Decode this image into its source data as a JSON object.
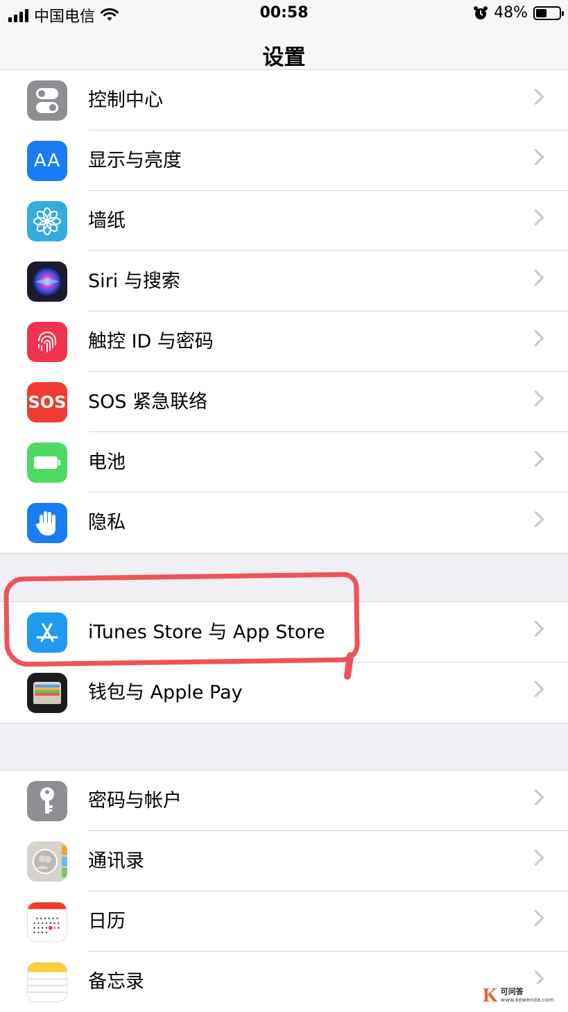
{
  "status_bar": {
    "carrier": "中国电信",
    "time": "00:58",
    "battery_percent": "48%",
    "battery_level": 0.48
  },
  "nav": {
    "title": "设置"
  },
  "groups": [
    {
      "items": [
        {
          "label": "控制中心",
          "icon": "control-center-icon",
          "color": "#8e8e93"
        },
        {
          "label": "显示与亮度",
          "icon": "display-brightness-icon",
          "color": "#1a7cf5"
        },
        {
          "label": "墙纸",
          "icon": "wallpaper-icon",
          "color": "#35aadc"
        },
        {
          "label": "Siri 与搜索",
          "icon": "siri-icon",
          "color": "#1c1c2e"
        },
        {
          "label": "触控 ID 与密码",
          "icon": "fingerprint-icon",
          "color": "#f2334f"
        },
        {
          "label": "SOS 紧急联络",
          "icon": "sos-icon",
          "color": "#f03b30"
        },
        {
          "label": "电池",
          "icon": "battery-icon",
          "color": "#4cd964"
        },
        {
          "label": "隐私",
          "icon": "privacy-hand-icon",
          "color": "#1a7cf5"
        }
      ]
    },
    {
      "items": [
        {
          "label": "iTunes Store 与 App Store",
          "icon": "app-store-icon",
          "color": "#1e9bf0"
        },
        {
          "label": "钱包与 Apple Pay",
          "icon": "wallet-icon",
          "color": "#1c1c1e"
        }
      ]
    },
    {
      "items": [
        {
          "label": "密码与帐户",
          "icon": "key-icon",
          "color": "#8e8e93"
        },
        {
          "label": "通讯录",
          "icon": "contacts-icon",
          "color": "#b8b4ae"
        },
        {
          "label": "日历",
          "icon": "calendar-icon",
          "color": "#ffffff"
        },
        {
          "label": "备忘录",
          "icon": "notes-icon",
          "color": "#ffffff"
        }
      ]
    }
  ],
  "icons": {
    "display_text": "AA",
    "sos_text": "SOS"
  },
  "watermark": {
    "logo": "K",
    "name": "可问答",
    "url": "www.kewenda.com"
  }
}
